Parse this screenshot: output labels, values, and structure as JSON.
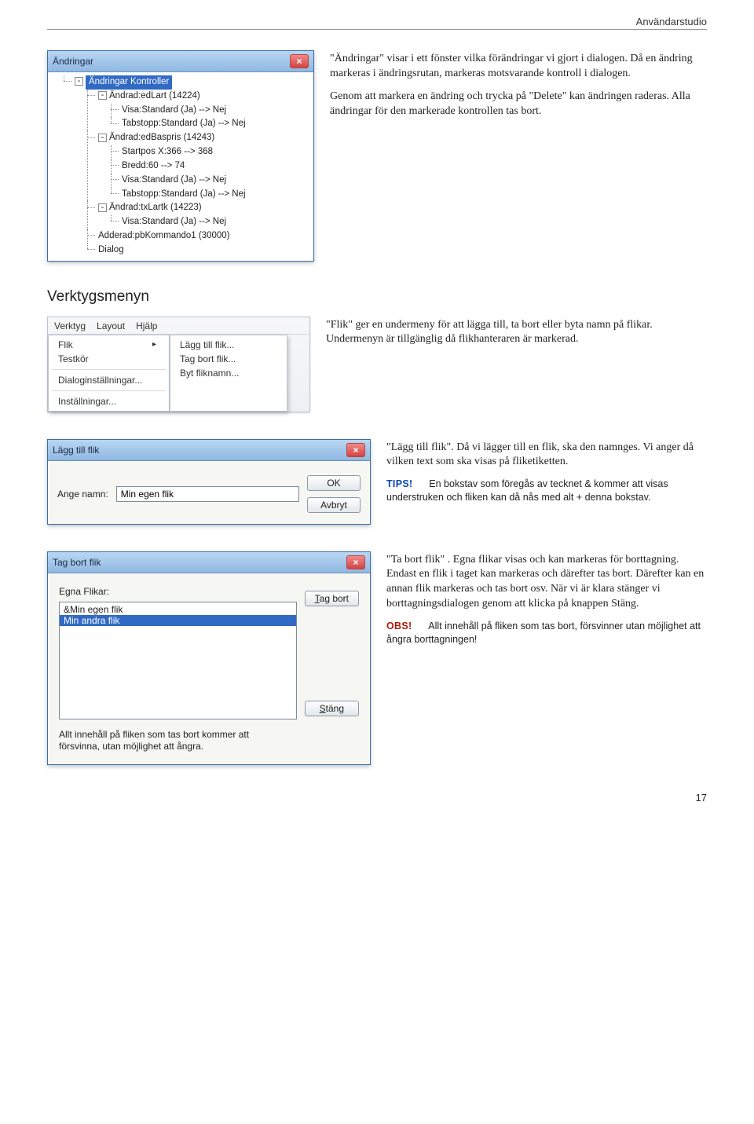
{
  "header_label": "Användarstudio",
  "sec1": {
    "p1": "\"Ändringar\" visar i ett fönster vilka förändringar vi gjort i dialogen. Då en ändring markeras i ändringsrutan, markeras motsvarande kontroll i dialogen.",
    "p2": "Genom att markera en ändring och trycka på \"Delete\" kan ändringen raderas. Alla ändringar för den markerade kontrollen tas bort."
  },
  "tree_panel": {
    "title": "Ändringar",
    "root": "Ändringar Kontroller",
    "items": [
      "Ändrad:edLart (14224)",
      "Visa:Standard (Ja) --> Nej",
      "Tabstopp:Standard (Ja) --> Nej",
      "Ändrad:edBaspris (14243)",
      "Startpos X:366 --> 368",
      "Bredd:60 --> 74",
      "Visa:Standard (Ja) --> Nej",
      "Tabstopp:Standard (Ja) --> Nej",
      "Ändrad:txLartk (14223)",
      "Visa:Standard (Ja) --> Nej",
      "Adderad:pbKommando1 (30000)",
      "Dialog"
    ]
  },
  "verktyg_heading": "Verktygsmenyn",
  "menu_panel": {
    "menubar": [
      "Verktyg",
      "Layout",
      "Hjälp"
    ],
    "col1": [
      "Flik",
      "Testkör",
      "Dialoginställningar...",
      "Inställningar..."
    ],
    "col2": [
      "Lägg till flik...",
      "Tag bort flik...",
      "Byt fliknamn..."
    ]
  },
  "sec2_p": "\"Flik\" ger en undermeny för att lägga till, ta bort eller byta namn på flikar. Undermenyn är tillgänglig då flikhanteraren är markerad.",
  "dlg_add": {
    "title": "Lägg till flik",
    "label": "Ange namn:",
    "value": "Min egen flik",
    "ok": "OK",
    "cancel": "Avbryt"
  },
  "sec3_p": "\"Lägg till flik\". Då vi lägger till en flik, ska den namnges. Vi anger då vilken text som ska visas på fliketiketten.",
  "tips": {
    "tag": "TIPS!",
    "text": "En bokstav som föregås av tecknet & kommer att visas understruken och fliken kan då nås med alt + denna bokstav."
  },
  "dlg_remove": {
    "title": "Tag bort flik",
    "list_label": "Egna Flikar:",
    "items": [
      "&Min egen flik",
      "Min andra flik"
    ],
    "btn_remove": "Tag bort",
    "warning": "Allt innehåll på fliken som tas bort kommer att försvinna, utan möjlighet att ångra.",
    "btn_close": "Stäng"
  },
  "sec4_p": "\"Ta bort flik\" . Egna flikar visas och kan markeras för borttagning. Endast en flik i taget kan markeras och därefter tas bort. Därefter kan en annan flik markeras och tas bort osv. När vi är klara stänger vi borttagningsdialogen genom att klicka på knappen Stäng.",
  "obs": {
    "tag": "OBS!",
    "text": "Allt innehåll på fliken som tas bort, försvinner utan möjlighet att ångra borttagningen!"
  },
  "page_number": "17"
}
